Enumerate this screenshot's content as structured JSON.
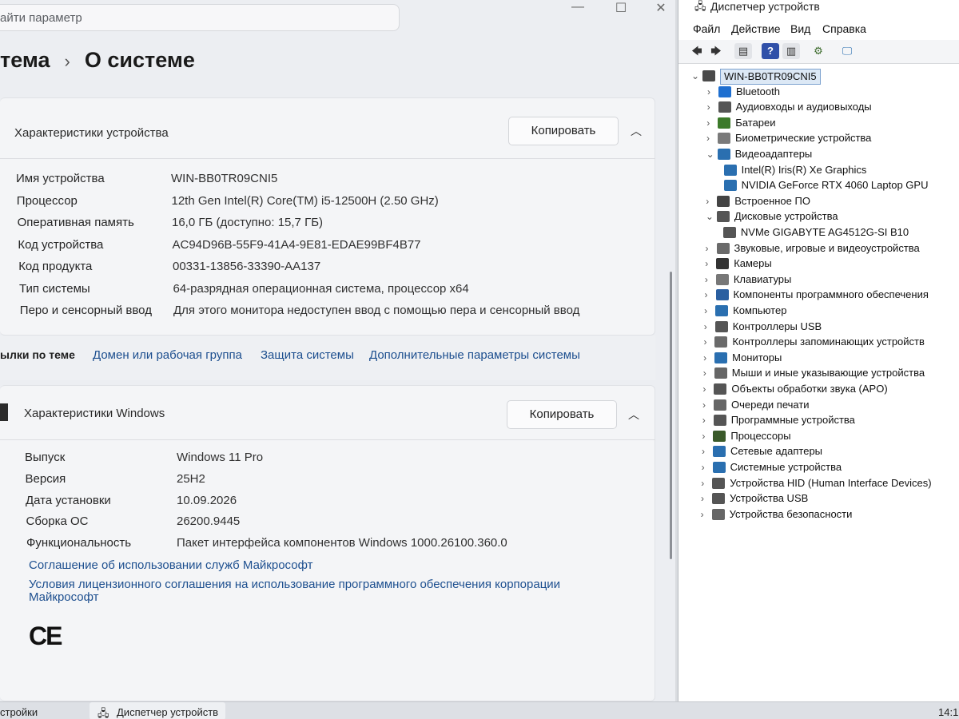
{
  "settings": {
    "search_text": "айти параметр",
    "window_controls": {
      "minimize": "—",
      "maximize": "☐",
      "close": "✕"
    },
    "breadcrumb": {
      "parent": "тема",
      "separator": "›",
      "current": "О системе"
    },
    "device_specs": {
      "title": "Характеристики устройства",
      "copy_label": "Копировать",
      "rows": [
        {
          "label": "Имя устройства",
          "value": "WIN-BB0TR09CNI5"
        },
        {
          "label": "Процессор",
          "value": "12th Gen Intel(R) Core(TM) i5-12500H (2.50 GHz)"
        },
        {
          "label": "Оперативная память",
          "value": "16,0 ГБ (доступно: 15,7 ГБ)"
        },
        {
          "label": "Код устройства",
          "value": "AC94D96B-55F9-41A4-9E81-EDAE99BF4B77"
        },
        {
          "label": "Код продукта",
          "value": "00331-13856-33390-AA137"
        },
        {
          "label": "Тип системы",
          "value": "64-разрядная операционная система, процессор x64"
        },
        {
          "label": "Перо и сенсорный ввод",
          "value": "Для этого монитора недоступен ввод с помощью пера и сенсорный ввод"
        }
      ]
    },
    "related": {
      "label": "ылки по теме",
      "links": [
        "Домен или рабочая группа",
        "Защита системы",
        "Дополнительные параметры системы"
      ]
    },
    "windows_specs": {
      "title": "Характеристики Windows",
      "copy_label": "Копировать",
      "rows": [
        {
          "label": "Выпуск",
          "value": "Windows 11 Pro"
        },
        {
          "label": "Версия",
          "value": "25H2"
        },
        {
          "label": "Дата установки",
          "value": "10.09.2026"
        },
        {
          "label": "Сборка ОС",
          "value": "26200.9445"
        },
        {
          "label": "Функциональность",
          "value": "Пакет интерфейса компонентов Windows 1000.26100.360.0"
        }
      ],
      "links": [
        "Соглашение об использовании служб Майкрософт",
        "Условия лицензионного соглашения на использование программного обеспечения корпорации",
        "Майкрософт"
      ],
      "ce_mark": "CE"
    }
  },
  "device_manager": {
    "title": "Диспетчер устройств",
    "menu": [
      "Файл",
      "Действие",
      "Вид",
      "Справка"
    ],
    "toolbar_icons": [
      "back-icon",
      "forward-icon",
      "properties-icon",
      "help-icon",
      "view-icon",
      "scan-icon",
      "monitor-icon"
    ],
    "root": "WIN-BB0TR09CNI5",
    "tree": [
      {
        "label": "Bluetooth",
        "expanded": false,
        "color": "#1e6fd0"
      },
      {
        "label": "Аудиовходы и аудиовыходы",
        "expanded": false,
        "color": "#555555"
      },
      {
        "label": "Батареи",
        "expanded": false,
        "color": "#3c7a2a"
      },
      {
        "label": "Биометрические устройства",
        "expanded": false,
        "color": "#7a7a7a"
      },
      {
        "label": "Видеоадаптеры",
        "expanded": true,
        "color": "#2a6fb0",
        "children": [
          "Intel(R) Iris(R) Xe Graphics",
          "NVIDIA GeForce RTX 4060 Laptop GPU"
        ]
      },
      {
        "label": "Встроенное ПО",
        "expanded": false,
        "color": "#444444"
      },
      {
        "label": "Дисковые устройства",
        "expanded": true,
        "color": "#555555",
        "children": [
          "NVMe GIGABYTE AG4512G-SI B10"
        ]
      },
      {
        "label": "Звуковые, игровые и видеоустройства",
        "expanded": false,
        "color": "#6a6a6a"
      },
      {
        "label": "Камеры",
        "expanded": false,
        "color": "#333333"
      },
      {
        "label": "Клавиатуры",
        "expanded": false,
        "color": "#777777"
      },
      {
        "label": "Компоненты программного обеспечения",
        "expanded": false,
        "color": "#2a5fa0"
      },
      {
        "label": "Компьютер",
        "expanded": false,
        "color": "#2a6fb0"
      },
      {
        "label": "Контроллеры USB",
        "expanded": false,
        "color": "#555555"
      },
      {
        "label": "Контроллеры запоминающих устройств",
        "expanded": false,
        "color": "#6a6a6a"
      },
      {
        "label": "Мониторы",
        "expanded": false,
        "color": "#2a6fb0"
      },
      {
        "label": "Мыши и иные указывающие устройства",
        "expanded": false,
        "color": "#666666"
      },
      {
        "label": "Объекты обработки звука (APO)",
        "expanded": false,
        "color": "#555555"
      },
      {
        "label": "Очереди печати",
        "expanded": false,
        "color": "#666666"
      },
      {
        "label": "Программные устройства",
        "expanded": false,
        "color": "#555555"
      },
      {
        "label": "Процессоры",
        "expanded": false,
        "color": "#3a5a2a"
      },
      {
        "label": "Сетевые адаптеры",
        "expanded": false,
        "color": "#2a6fb0"
      },
      {
        "label": "Системные устройства",
        "expanded": false,
        "color": "#2a6fb0"
      },
      {
        "label": "Устройства HID (Human Interface Devices)",
        "expanded": false,
        "color": "#555555"
      },
      {
        "label": "Устройства USB",
        "expanded": false,
        "color": "#555555"
      },
      {
        "label": "Устройства безопасности",
        "expanded": false,
        "color": "#666666"
      }
    ]
  },
  "taskbar": {
    "left_item": "стройки",
    "active_item": "Диспетчер устройств",
    "clock": "14:1"
  }
}
